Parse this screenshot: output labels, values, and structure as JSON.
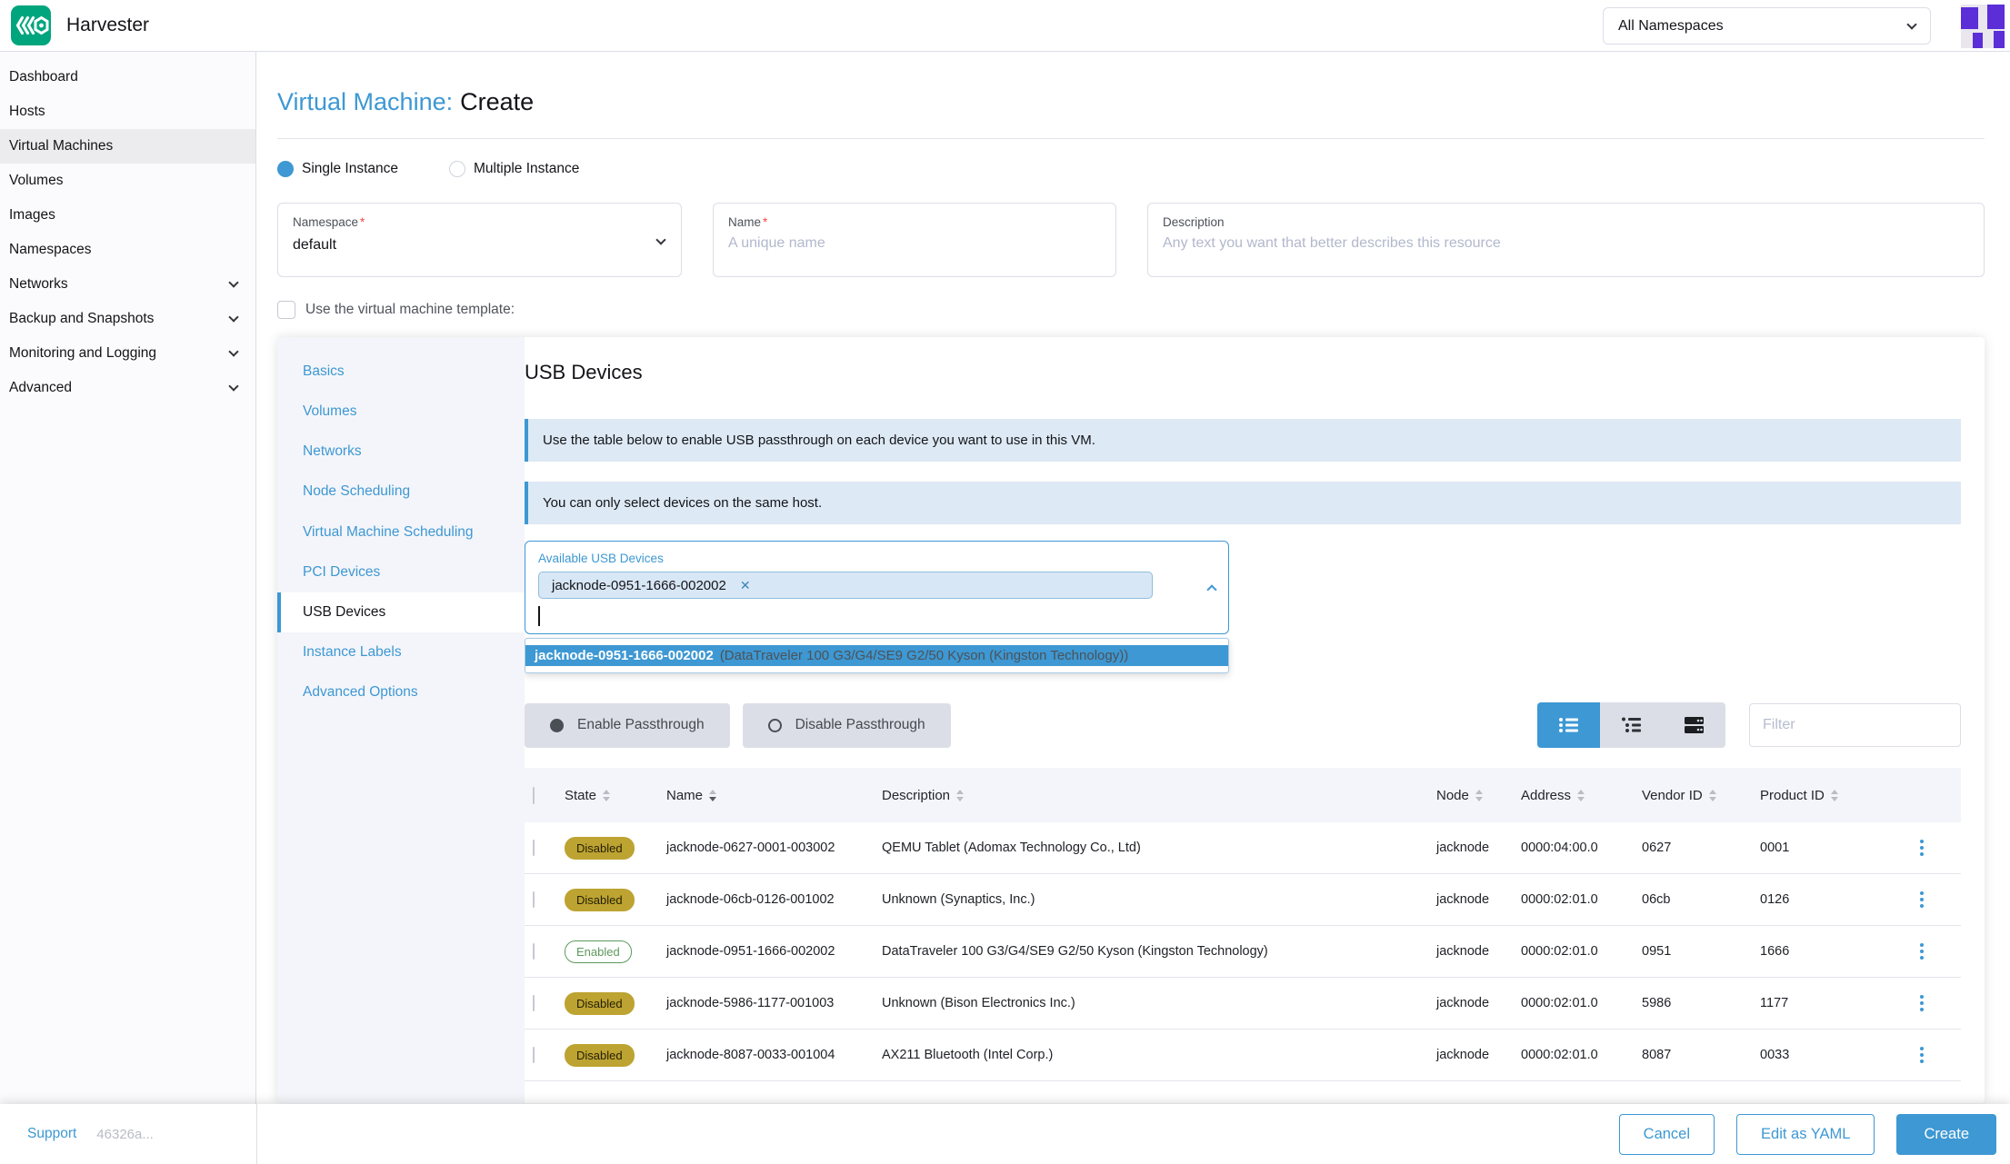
{
  "colors": {
    "accent": "#3d98d3",
    "disabled_badge": "#bda331",
    "enabled_badge": "#5d995d"
  },
  "header": {
    "app_name": "Harvester",
    "namespace_filter": "All Namespaces"
  },
  "sidebar": {
    "items": [
      {
        "label": "Dashboard"
      },
      {
        "label": "Hosts"
      },
      {
        "label": "Virtual Machines"
      },
      {
        "label": "Volumes"
      },
      {
        "label": "Images"
      },
      {
        "label": "Namespaces"
      },
      {
        "label": "Networks"
      },
      {
        "label": "Backup and Snapshots"
      },
      {
        "label": "Monitoring and Logging"
      },
      {
        "label": "Advanced"
      }
    ],
    "selected": "Virtual Machines",
    "support_link": "Support",
    "version": "46326a..."
  },
  "page": {
    "title_resource": "Virtual Machine:",
    "title_action": "Create",
    "instance_mode": {
      "options": [
        "Single Instance",
        "Multiple Instance"
      ],
      "selected": "Single Instance"
    }
  },
  "form": {
    "namespace": {
      "label": "Namespace",
      "required_marker": "*",
      "value": "default"
    },
    "name": {
      "label": "Name",
      "required_marker": "*",
      "placeholder": "A unique name"
    },
    "description": {
      "label": "Description",
      "placeholder": "Any text you want that better describes this resource"
    },
    "template_checkbox_label": "Use the virtual machine template:"
  },
  "vm_tabs": {
    "items": [
      "Basics",
      "Volumes",
      "Networks",
      "Node Scheduling",
      "Virtual Machine Scheduling",
      "PCI Devices",
      "USB Devices",
      "Instance Labels",
      "Advanced Options"
    ],
    "active": "USB Devices"
  },
  "usb_section": {
    "heading": "USB Devices",
    "banners": [
      "Use the table below to enable USB passthrough on each device you want to use in this VM.",
      "You can only select devices on the same host."
    ],
    "device_picker": {
      "label": "Available USB Devices",
      "selected_tag": "jacknode-0951-1666-002002",
      "remove_icon": "✕",
      "dropdown_option": {
        "name": "jacknode-0951-1666-002002",
        "detail": "(DataTraveler 100 G3/G4/SE9 G2/50 Kyson (Kingston Technology))"
      }
    },
    "actions": {
      "enable": "Enable Passthrough",
      "disable": "Disable Passthrough"
    },
    "filter_placeholder": "Filter"
  },
  "table": {
    "columns": [
      "State",
      "Name",
      "Description",
      "Node",
      "Address",
      "Vendor ID",
      "Product ID"
    ],
    "sorted_by": "Name",
    "rows": [
      {
        "state": "Disabled",
        "name": "jacknode-0627-0001-003002",
        "description": "QEMU Tablet (Adomax Technology Co., Ltd)",
        "node": "jacknode",
        "address": "0000:04:00.0",
        "vendor_id": "0627",
        "product_id": "0001"
      },
      {
        "state": "Disabled",
        "name": "jacknode-06cb-0126-001002",
        "description": "Unknown (Synaptics, Inc.)",
        "node": "jacknode",
        "address": "0000:02:01.0",
        "vendor_id": "06cb",
        "product_id": "0126"
      },
      {
        "state": "Enabled",
        "name": "jacknode-0951-1666-002002",
        "description": "DataTraveler 100 G3/G4/SE9 G2/50 Kyson (Kingston Technology)",
        "node": "jacknode",
        "address": "0000:02:01.0",
        "vendor_id": "0951",
        "product_id": "1666"
      },
      {
        "state": "Disabled",
        "name": "jacknode-5986-1177-001003",
        "description": "Unknown (Bison Electronics Inc.)",
        "node": "jacknode",
        "address": "0000:02:01.0",
        "vendor_id": "5986",
        "product_id": "1177"
      },
      {
        "state": "Disabled",
        "name": "jacknode-8087-0033-001004",
        "description": "AX211 Bluetooth (Intel Corp.)",
        "node": "jacknode",
        "address": "0000:02:01.0",
        "vendor_id": "8087",
        "product_id": "0033"
      }
    ]
  },
  "footer": {
    "cancel": "Cancel",
    "edit_yaml": "Edit as YAML",
    "create": "Create"
  }
}
